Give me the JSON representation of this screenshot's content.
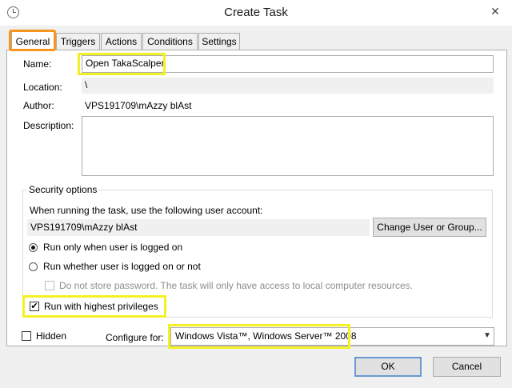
{
  "window": {
    "title": "Create Task",
    "close_glyph": "✕"
  },
  "tabs": [
    {
      "label": "General"
    },
    {
      "label": "Triggers"
    },
    {
      "label": "Actions"
    },
    {
      "label": "Conditions"
    },
    {
      "label": "Settings"
    }
  ],
  "general": {
    "name_label": "Name:",
    "name_value": "Open TakaScalper",
    "location_label": "Location:",
    "location_value": "\\",
    "author_label": "Author:",
    "author_value": "VPS191709\\mAzzy blAst",
    "description_label": "Description:",
    "description_value": ""
  },
  "security": {
    "legend": "Security options",
    "account_prompt": "When running the task, use the following user account:",
    "account_value": "VPS191709\\mAzzy blAst",
    "change_button": "Change User or Group...",
    "radio_logged_on": "Run only when user is logged on",
    "radio_whether": "Run whether user is logged on or not",
    "no_store_password": "Do not store password.  The task will only have access to local computer resources.",
    "highest_privileges": "Run with highest privileges",
    "highest_privileges_checked": true,
    "selected_radio": "Run only when user is logged on"
  },
  "footer": {
    "hidden_label": "Hidden",
    "hidden_checked": false,
    "configure_label": "Configure for:",
    "configure_value": "Windows Vista™, Windows Server™ 2008",
    "ok_button": "OK",
    "cancel_button": "Cancel"
  },
  "colors": {
    "highlight_yellow": "#f3f125",
    "highlight_orange": "#f7961c",
    "dialog_background": "#f0f0f0"
  },
  "icons": [
    "task-scheduler-clock-icon",
    "close-icon",
    "dropdown-arrow-icon",
    "checkmark-icon"
  ]
}
